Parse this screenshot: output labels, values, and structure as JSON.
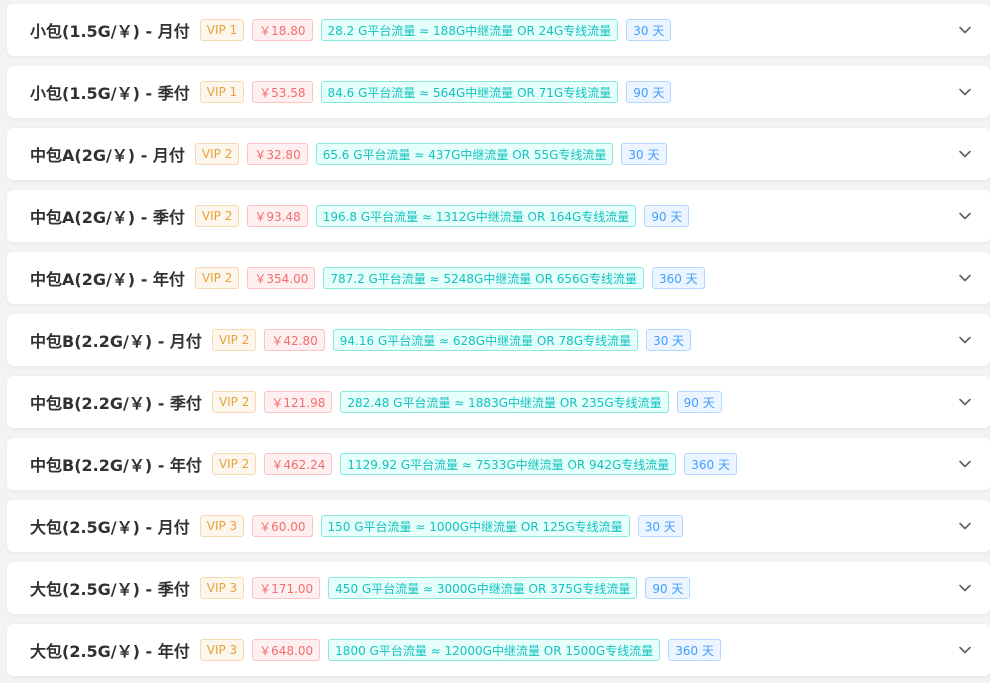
{
  "colors": {
    "vip": "#e6a23c",
    "price": "#f56c6c",
    "flow": "#13c2c2",
    "days": "#409eff"
  },
  "plans": [
    {
      "title": "小包(1.5G/￥) - 月付",
      "vip": "VIP 1",
      "price": "￥18.80",
      "traffic": "28.2 G平台流量 ≈ 188G中继流量 OR 24G专线流量",
      "days": "30 天"
    },
    {
      "title": "小包(1.5G/￥) - 季付",
      "vip": "VIP 1",
      "price": "￥53.58",
      "traffic": "84.6 G平台流量 ≈ 564G中继流量 OR 71G专线流量",
      "days": "90 天"
    },
    {
      "title": "中包A(2G/￥) - 月付",
      "vip": "VIP 2",
      "price": "￥32.80",
      "traffic": "65.6 G平台流量 ≈ 437G中继流量 OR 55G专线流量",
      "days": "30 天"
    },
    {
      "title": "中包A(2G/￥) - 季付",
      "vip": "VIP 2",
      "price": "￥93.48",
      "traffic": "196.8 G平台流量 ≈ 1312G中继流量 OR 164G专线流量",
      "days": "90 天"
    },
    {
      "title": "中包A(2G/￥) - 年付",
      "vip": "VIP 2",
      "price": "￥354.00",
      "traffic": "787.2 G平台流量 ≈ 5248G中继流量 OR 656G专线流量",
      "days": "360 天"
    },
    {
      "title": "中包B(2.2G/￥) - 月付",
      "vip": "VIP 2",
      "price": "￥42.80",
      "traffic": "94.16 G平台流量 ≈ 628G中继流量 OR 78G专线流量",
      "days": "30 天"
    },
    {
      "title": "中包B(2.2G/￥) - 季付",
      "vip": "VIP 2",
      "price": "￥121.98",
      "traffic": "282.48 G平台流量 ≈ 1883G中继流量 OR 235G专线流量",
      "days": "90 天"
    },
    {
      "title": "中包B(2.2G/￥) - 年付",
      "vip": "VIP 2",
      "price": "￥462.24",
      "traffic": "1129.92 G平台流量 ≈ 7533G中继流量 OR 942G专线流量",
      "days": "360 天"
    },
    {
      "title": "大包(2.5G/￥) - 月付",
      "vip": "VIP 3",
      "price": "￥60.00",
      "traffic": "150 G平台流量 ≈ 1000G中继流量 OR 125G专线流量",
      "days": "30 天"
    },
    {
      "title": "大包(2.5G/￥) - 季付",
      "vip": "VIP 3",
      "price": "￥171.00",
      "traffic": "450 G平台流量 ≈ 3000G中继流量 OR 375G专线流量",
      "days": "90 天"
    },
    {
      "title": "大包(2.5G/￥) - 年付",
      "vip": "VIP 3",
      "price": "￥648.00",
      "traffic": "1800 G平台流量 ≈ 12000G中继流量 OR 1500G专线流量",
      "days": "360 天"
    }
  ],
  "icons": {
    "expand": "chevron-down-icon"
  }
}
